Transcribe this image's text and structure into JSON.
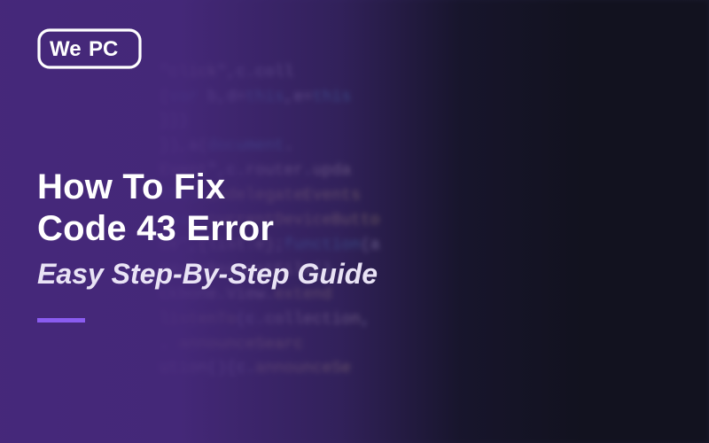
{
  "logo": {
    "text_we": "We",
    "text_pc": "PC"
  },
  "headline_line1": "How To Fix",
  "headline_line2": "Code 43 Error",
  "subhead": "Easy Step-By-Step Guide",
  "accent_color": "#8a5cf0",
  "code_bg": {
    "lines": [
      [
        {
          "t": "\"",
          "c": "white"
        },
        {
          "t": "click",
          "c": "cream"
        },
        {
          "t": "\",c.coll",
          "c": "white"
        }
      ],
      [
        {
          "t": "(",
          "c": "white"
        },
        {
          "t": "var",
          "c": "cyan"
        },
        {
          "t": " b,d=",
          "c": "white"
        },
        {
          "t": "this",
          "c": "cyan"
        },
        {
          "t": ",e=",
          "c": "white"
        },
        {
          "t": "this",
          "c": "cyan"
        }
      ],
      [
        {
          "t": "}}}",
          "c": "white"
        }
      ],
      [
        {
          "t": "}),a(",
          "c": "white"
        },
        {
          "t": "document",
          "c": "cyan"
        },
        {
          "t": ".",
          "c": "white"
        }
      ],
      [
        {
          "t": "Event",
          "c": "cream"
        },
        {
          "t": "\",c.",
          "c": "white"
        },
        {
          "t": "router",
          "c": "cream"
        },
        {
          "t": ".",
          "c": "white"
        },
        {
          "t": "upda",
          "c": "cream"
        }
      ],
      [
        {
          "t": "this",
          "c": "cyan"
        },
        {
          "t": ".",
          "c": "white"
        },
        {
          "t": "undelegateEvents",
          "c": "yellow"
        }
      ],
      [
        {
          "t": "this",
          "c": "cyan"
        },
        {
          "t": ".",
          "c": "white"
        },
        {
          "t": "currentDeviceButto",
          "c": "yellow"
        }
      ],
      [
        {
          "t": "ce",
          "c": "cream"
        },
        {
          "t": "\",",
          "c": "white"
        },
        {
          "t": "{list:e}",
          "c": "cream"
        },
        {
          "t": ";",
          "c": "white"
        },
        {
          "t": "function",
          "c": "cyan"
        },
        {
          "t": "(a",
          "c": "white"
        }
      ],
      [
        {
          "t": "maybeRequestFile",
          "c": "cream"
        },
        {
          "t": "()",
          "c": "white"
        }
      ],
      [
        {
          "t": "ckbone.View.",
          "c": "cream"
        },
        {
          "t": "extend",
          "c": "yellow"
        }
      ],
      [
        {
          "t": "listenTo",
          "c": "yellow"
        },
        {
          "t": "(c.",
          "c": "white"
        },
        {
          "t": "collection",
          "c": "cream"
        },
        {
          "t": ",",
          "c": "white"
        }
      ],
      [
        {
          "t": ". ",
          "c": "white"
        },
        {
          "t": "announceSearc",
          "c": "yellow"
        }
      ],
      [
        {
          "t": "ution",
          "c": "cream"
        },
        {
          "t": "()",
          "c": "white"
        },
        {
          "t": "{",
          "c": "white"
        },
        {
          "t": "c.",
          "c": "white"
        },
        {
          "t": "announceSe",
          "c": "yellow"
        }
      ]
    ]
  }
}
